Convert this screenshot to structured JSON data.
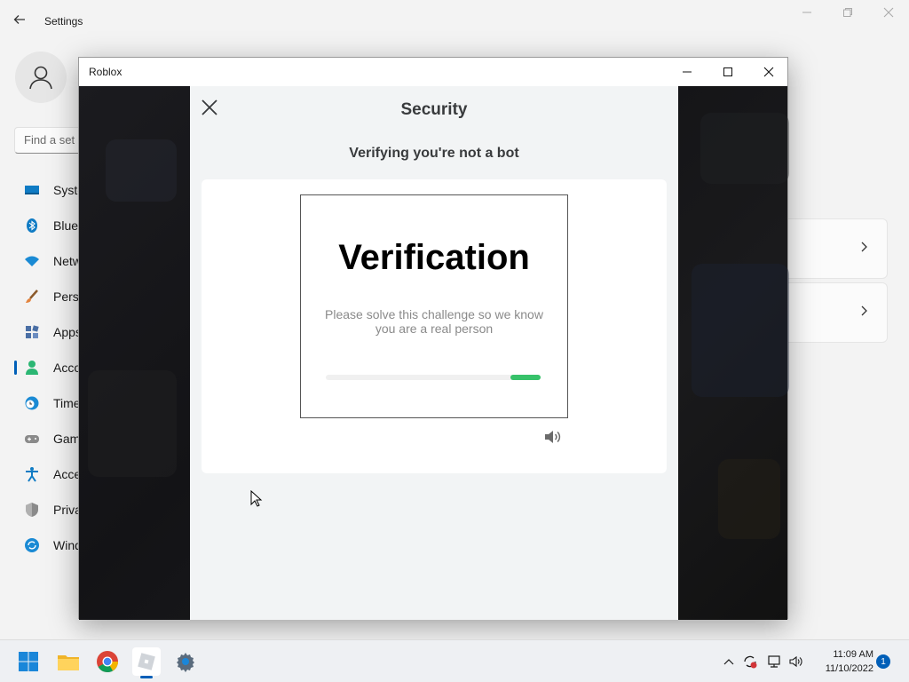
{
  "settings": {
    "title": "Settings",
    "search_placeholder": "Find a set",
    "nav": [
      {
        "label": "Syste",
        "icon": "display-icon",
        "color": "#0078d4"
      },
      {
        "label": "Blue",
        "icon": "bluetooth-icon",
        "color": "#0078d4"
      },
      {
        "label": "Netw",
        "icon": "wifi-icon",
        "color": "#0078d4"
      },
      {
        "label": "Perso",
        "icon": "brush-icon",
        "color": "#e3833d"
      },
      {
        "label": "Apps",
        "icon": "apps-icon",
        "color": "#4a6fa5"
      },
      {
        "label": "Acco",
        "icon": "person-icon",
        "color": "#2bb673"
      },
      {
        "label": "Time",
        "icon": "clock-globe-icon",
        "color": "#0078d4"
      },
      {
        "label": "Gam",
        "icon": "gamepad-icon",
        "color": "#777777"
      },
      {
        "label": "Acce",
        "icon": "accessibility-icon",
        "color": "#0078d4"
      },
      {
        "label": "Priva",
        "icon": "shield-icon",
        "color": "#777777"
      },
      {
        "label": "Wind",
        "icon": "update-icon",
        "color": "#0078d4"
      }
    ],
    "active_nav_index": 5
  },
  "roblox": {
    "title": "Roblox"
  },
  "security": {
    "title": "Security",
    "subtitle": "Verifying you're not a bot",
    "challenge_title": "Verification",
    "challenge_text": "Please solve this challenge so we know you are a real person",
    "progress_color": "#37c26a"
  },
  "taskbar": {
    "apps": [
      "windows-start-icon",
      "file-explorer-icon",
      "chrome-icon",
      "roblox-icon",
      "settings-gear-icon"
    ],
    "active_app": "roblox-icon",
    "time": "11:09 AM",
    "date": "11/10/2022",
    "notification_count": "1"
  }
}
